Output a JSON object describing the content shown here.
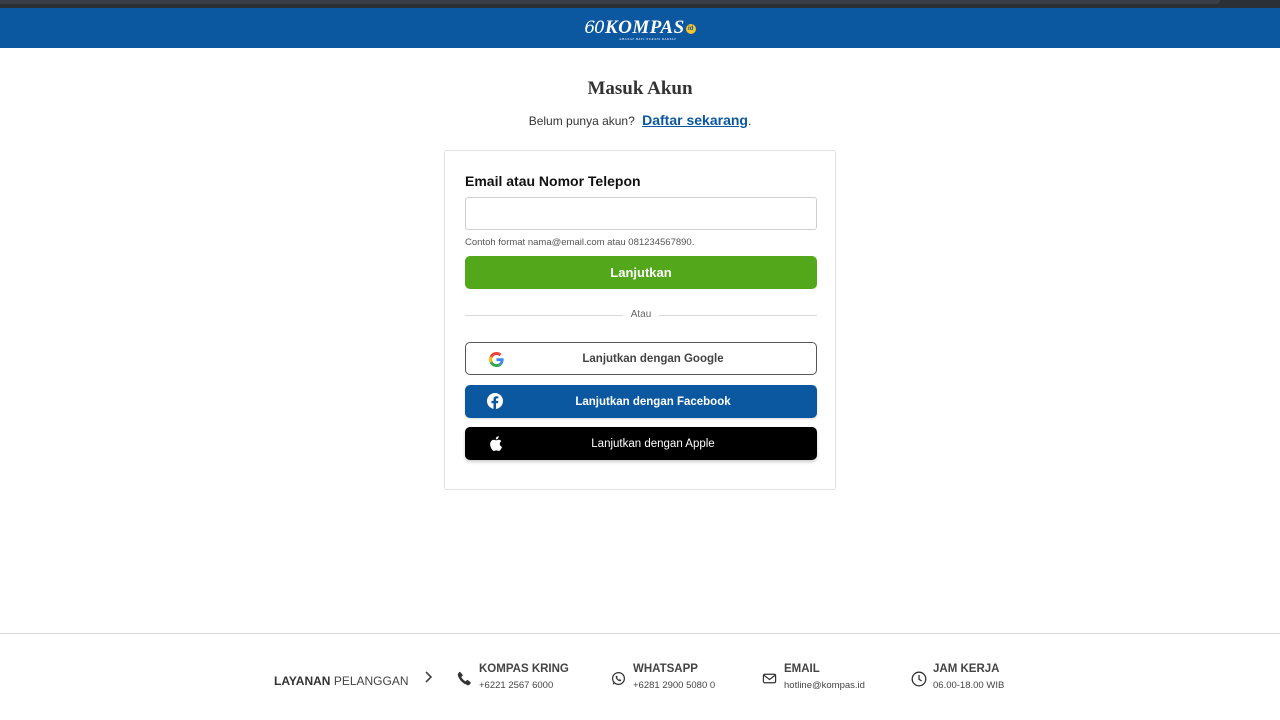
{
  "header": {
    "logo_sixty": "60",
    "logo_word": "KOMPAS",
    "logo_suffix": "id",
    "logo_tagline": "AMANAT HATI NURANI RAKYAT"
  },
  "page": {
    "title": "Masuk Akun",
    "subtitle": "Belum punya akun?",
    "register_link": "Daftar sekarang",
    "register_suffix": "."
  },
  "form": {
    "label": "Email atau Nomor Telepon",
    "input_value": "",
    "input_placeholder": "",
    "hint": "Contoh format nama@email.com atau 081234567890.",
    "continue_label": "Lanjutkan",
    "divider_text": "Atau",
    "google_label": "Lanjutkan dengan Google",
    "facebook_label": "Lanjutkan dengan Facebook",
    "apple_label": "Lanjutkan dengan Apple"
  },
  "footer": {
    "cs_bold": "LAYANAN",
    "cs_rest": "PELANGGAN",
    "items": [
      {
        "title": "KOMPAS KRING",
        "value": "+6221 2567 6000",
        "icon": "phone-icon"
      },
      {
        "title": "WHATSAPP",
        "value": "+6281 2900 5080 0",
        "icon": "whatsapp-icon"
      },
      {
        "title": "EMAIL",
        "value": "hotline@kompas.id",
        "icon": "mail-icon"
      },
      {
        "title": "JAM KERJA",
        "value": "06.00-18.00 WIB",
        "icon": "clock-icon"
      }
    ]
  },
  "colors": {
    "brand_blue": "#0b58a1",
    "continue_green": "#52a81a",
    "apple_black": "#000000"
  }
}
